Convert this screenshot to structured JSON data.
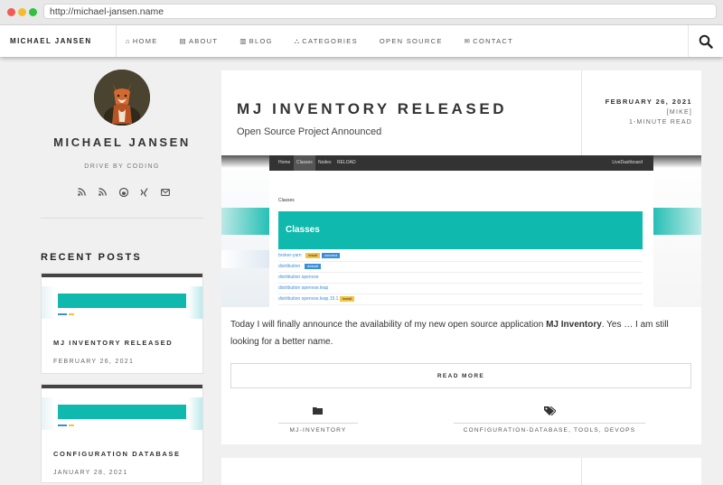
{
  "browser": {
    "url": "http://michael-jansen.name"
  },
  "nav": {
    "brand": "MICHAEL JANSEN",
    "items": [
      {
        "label": "HOME",
        "icon": "home-icon",
        "glyph": "⌂"
      },
      {
        "label": "ABOUT",
        "icon": "id-card-icon",
        "glyph": "▤"
      },
      {
        "label": "BLOG",
        "icon": "newspaper-icon",
        "glyph": "▥"
      },
      {
        "label": "CATEGORIES",
        "icon": "sitemap-icon",
        "glyph": "⛬"
      },
      {
        "label": "OPEN SOURCE",
        "icon": "",
        "glyph": ""
      },
      {
        "label": "CONTACT",
        "icon": "envelope-icon",
        "glyph": "✉"
      }
    ]
  },
  "sidebar": {
    "name": "MICHAEL JANSEN",
    "tagline": "DRIVE BY CODING",
    "social": [
      "rss-icon",
      "rss-icon",
      "github-icon",
      "xing-icon",
      "envelope-icon"
    ],
    "recent_heading": "RECENT POSTS",
    "recent_posts": [
      {
        "title": "MJ INVENTORY RELEASED",
        "date": "FEBRUARY 26, 2021"
      },
      {
        "title": "CONFIGURATION DATABASE",
        "date": "JANUARY 28, 2021"
      }
    ]
  },
  "post": {
    "title": "MJ INVENTORY RELEASED",
    "subtitle": "Open Source Project Announced",
    "date": "FEBRUARY 26, 2021",
    "author": "[MIKE]",
    "reading_time": "1-MINUTE READ",
    "excerpt_before": "Today I will finally announce the availability of my new open source application ",
    "excerpt_bold": "MJ Inventory",
    "excerpt_after": ". Yes … I am still looking for a better name.",
    "read_more": "READ MORE",
    "categories": [
      "MJ-INVENTORY"
    ],
    "tags": [
      "CONFIGURATION-DATABASE",
      "TOOLS",
      "DEVOPS"
    ]
  },
  "screenshot": {
    "nav": [
      "Home",
      "Classes",
      "Nodes",
      "RELOAD"
    ],
    "nav_right": "LiveDashboard",
    "breadcrumb": "Classes",
    "banner": "Classes",
    "rows": [
      {
        "label": "broker-yarn",
        "badges": [
          "install",
          "connect"
        ]
      },
      {
        "label": "distribution",
        "badges": [
          "default"
        ]
      },
      {
        "label": "distribution openvse",
        "badges": []
      },
      {
        "label": "distribution openvse.leap",
        "badges": []
      },
      {
        "label": "distribution openvse.leap.15.1",
        "badges": [
          "install"
        ]
      }
    ]
  },
  "colors": {
    "accent": "#0fb9ad",
    "badge_yellow": "#f4c542",
    "badge_blue": "#3b8fd9",
    "link": "#3b8fd9"
  }
}
